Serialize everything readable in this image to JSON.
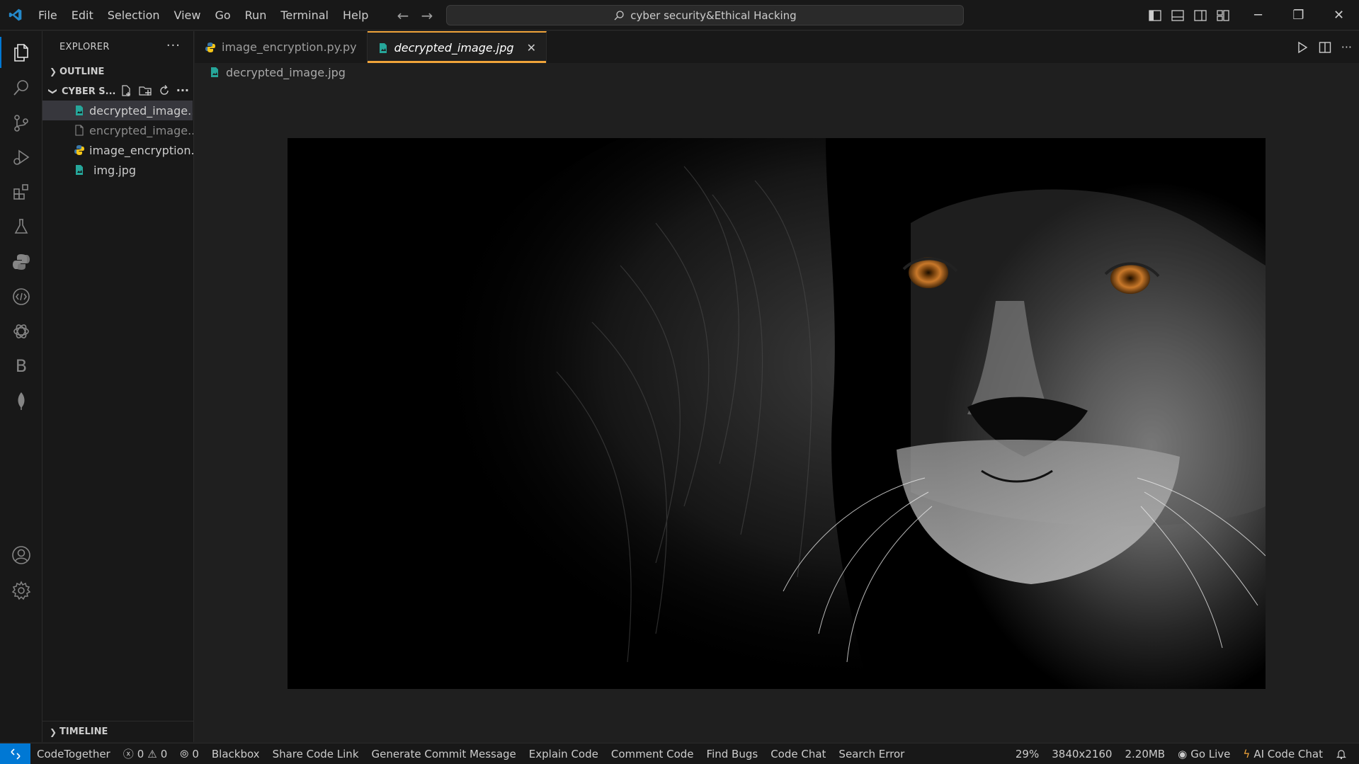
{
  "menu": [
    "File",
    "Edit",
    "Selection",
    "View",
    "Go",
    "Run",
    "Terminal",
    "Help"
  ],
  "command_center": "cyber security&Ethical Hacking",
  "sidebar": {
    "title": "EXPLORER",
    "outline_label": "OUTLINE",
    "folder_label": "CYBER S...",
    "files": [
      {
        "name": "decrypted_image....",
        "icon": "image-icon"
      },
      {
        "name": "encrypted_image....",
        "icon": "file-icon"
      },
      {
        "name": "image_encryption...",
        "icon": "python-icon"
      },
      {
        "name": "img.jpg",
        "icon": "image-icon"
      }
    ],
    "timeline_label": "TIMELINE"
  },
  "tabs": [
    {
      "label": "image_encryption.py.py",
      "active": false
    },
    {
      "label": "decrypted_image.jpg",
      "active": true
    }
  ],
  "breadcrumb": "decrypted_image.jpg",
  "statusbar": {
    "left": [
      "CodeTogether",
      "0",
      "0",
      "0",
      "Blackbox",
      "Share Code Link",
      "Generate Commit Message",
      "Explain Code",
      "Comment Code",
      "Find Bugs",
      "Code Chat",
      "Search Error"
    ],
    "zoom": "29%",
    "dimensions": "3840x2160",
    "size": "2.20MB",
    "go_live": "Go Live",
    "ai_chat": "AI Code Chat"
  },
  "colors": {
    "accent": "#0078d4",
    "active_tab": "#f0a43a",
    "lion_eyes": "#c8782a"
  }
}
